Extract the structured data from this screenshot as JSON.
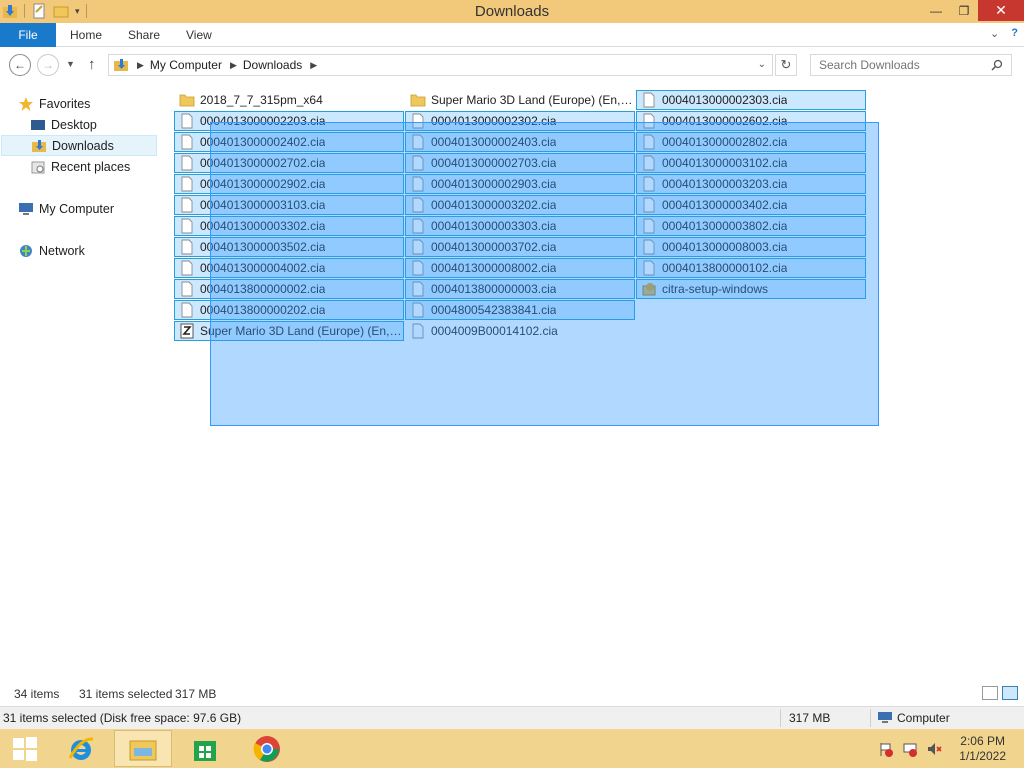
{
  "window": {
    "title": "Downloads"
  },
  "ribbon": {
    "tabs": [
      "File",
      "Home",
      "Share",
      "View"
    ]
  },
  "address": {
    "crumbs": [
      "My Computer",
      "Downloads"
    ]
  },
  "search": {
    "placeholder": "Search Downloads"
  },
  "nav": {
    "favorites": "Favorites",
    "desktop": "Desktop",
    "downloads": "Downloads",
    "recent": "Recent places",
    "computer": "My Computer",
    "network": "Network"
  },
  "files": [
    {
      "name": "2018_7_7_315pm_x64",
      "type": "folder",
      "selected": false
    },
    {
      "name": "0004013000002203.cia",
      "type": "file",
      "selected": true
    },
    {
      "name": "0004013000002402.cia",
      "type": "file",
      "selected": true
    },
    {
      "name": "0004013000002702.cia",
      "type": "file",
      "selected": true
    },
    {
      "name": "0004013000002902.cia",
      "type": "file",
      "selected": true
    },
    {
      "name": "0004013000003103.cia",
      "type": "file",
      "selected": true
    },
    {
      "name": "0004013000003302.cia",
      "type": "file",
      "selected": true
    },
    {
      "name": "0004013000003502.cia",
      "type": "file",
      "selected": true
    },
    {
      "name": "0004013000004002.cia",
      "type": "file",
      "selected": true
    },
    {
      "name": "0004013800000002.cia",
      "type": "file",
      "selected": true
    },
    {
      "name": "0004013800000202.cia",
      "type": "file",
      "selected": true
    },
    {
      "name": "Super Mario 3D Land (Europe) (En,Fr...",
      "type": "zip",
      "selected": true
    },
    {
      "name": "Super Mario 3D Land (Europe) (En,Fr...",
      "type": "folder",
      "selected": false
    },
    {
      "name": "0004013000002302.cia",
      "type": "file",
      "selected": true
    },
    {
      "name": "0004013000002403.cia",
      "type": "file",
      "selected": true
    },
    {
      "name": "0004013000002703.cia",
      "type": "file",
      "selected": true
    },
    {
      "name": "0004013000002903.cia",
      "type": "file",
      "selected": true
    },
    {
      "name": "0004013000003202.cia",
      "type": "file",
      "selected": true
    },
    {
      "name": "0004013000003303.cia",
      "type": "file",
      "selected": true
    },
    {
      "name": "0004013000003702.cia",
      "type": "file",
      "selected": true
    },
    {
      "name": "0004013000008002.cia",
      "type": "file",
      "selected": true
    },
    {
      "name": "0004013800000003.cia",
      "type": "file",
      "selected": true
    },
    {
      "name": "0004800542383841.cia",
      "type": "file",
      "selected": true
    },
    {
      "name": "0004009B00014102.cia",
      "type": "file",
      "selected": false
    },
    {
      "name": "0004013000002303.cia",
      "type": "file",
      "selected": true
    },
    {
      "name": "0004013000002602.cia",
      "type": "file",
      "selected": true
    },
    {
      "name": "0004013000002802.cia",
      "type": "file",
      "selected": true
    },
    {
      "name": "0004013000003102.cia",
      "type": "file",
      "selected": true
    },
    {
      "name": "0004013000003203.cia",
      "type": "file",
      "selected": true
    },
    {
      "name": "0004013000003402.cia",
      "type": "file",
      "selected": true
    },
    {
      "name": "0004013000003802.cia",
      "type": "file",
      "selected": true
    },
    {
      "name": "0004013000008003.cia",
      "type": "file",
      "selected": true
    },
    {
      "name": "0004013800000102.cia",
      "type": "file",
      "selected": true
    },
    {
      "name": "citra-setup-windows",
      "type": "setup",
      "selected": true
    }
  ],
  "status": {
    "count": "34 items",
    "selected": "31 items selected",
    "size": "317 MB"
  },
  "details": {
    "text": "31 items selected (Disk free space: 97.6 GB)",
    "size": "317 MB",
    "location": "Computer"
  },
  "clock": {
    "time": "2:06 PM",
    "date": "1/1/2022"
  },
  "colors": {
    "title_bar": "#f2c97b",
    "file_tab": "#1979ca",
    "selection": "#cce8ff",
    "taskbar": "#f1d58e"
  }
}
